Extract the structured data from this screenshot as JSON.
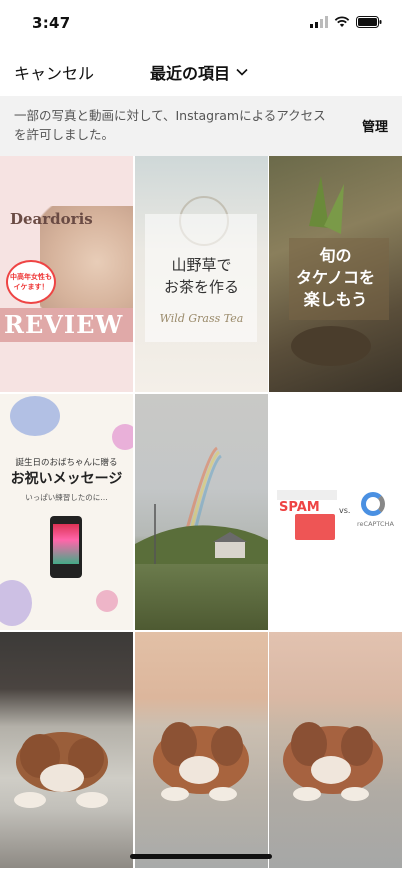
{
  "status": {
    "time": "3:47",
    "icons": [
      "signal-icon",
      "wifi-icon",
      "battery-icon"
    ]
  },
  "nav": {
    "cancel_label": "キャンセル",
    "album_title": "最近の項目",
    "album_chevron": "chevron-down-icon"
  },
  "notice": {
    "text": "一部の写真と動画に対して、Instagramによるアクセスを許可しました。",
    "manage_label": "管理"
  },
  "photos": {
    "p1": {
      "logo": "Deardoris",
      "badge": "中高年女性もイケます！",
      "caption": "REVIEW"
    },
    "p2": {
      "line1": "山野草で",
      "line2": "お茶を作る",
      "script": "Wild Grass Tea"
    },
    "p3": {
      "line1": "旬の",
      "line2": "タケノコを",
      "line3": "楽しもう"
    },
    "p4": {
      "small": "誕生日のおばちゃんに贈る",
      "big": "お祝いメッセージ",
      "tiny": "いっぱい練習したのに…"
    },
    "p6": {
      "spam": "SPAM",
      "vs": "vs.",
      "recaptcha": "reCAPTCHA"
    }
  },
  "colors": {
    "background": "#ffffff",
    "notice_bg": "#f2f2f2",
    "text_primary": "#111111",
    "text_secondary": "#555555"
  }
}
